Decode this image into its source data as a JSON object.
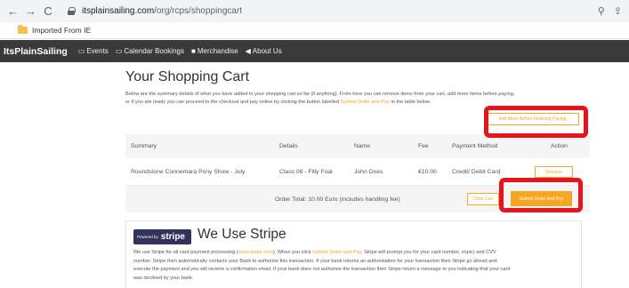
{
  "browser": {
    "url_host": "itsplainsailing.com",
    "url_path": "/org/rcps/shoppingcart",
    "bookmark": "Imported From IE"
  },
  "site_nav": {
    "brand": "ItsPlainSailing",
    "items": [
      {
        "icon": "calendar-icon",
        "label": "Events"
      },
      {
        "icon": "calendar-icon",
        "label": "Calendar Bookings"
      },
      {
        "icon": "shop-icon",
        "label": "Merchandise"
      },
      {
        "icon": "megaphone-icon",
        "label": "About Us"
      }
    ]
  },
  "cart": {
    "title": "Your Shopping Cart",
    "intro_1": "Below are the summary details of what you have added to your shopping cart so far (if anything). From here you can remove items from your cart, add more items before paying,",
    "intro_2a": "or if you are ready you can proceed to the checkout and pay online by clicking the button labelled",
    "intro_link": "Submit Order and Pay",
    "intro_2b": "in the table below.",
    "add_more_label": "Add More Before Finishing Paying",
    "table": {
      "headers": {
        "summary": "Summary",
        "details": "Details",
        "name": "Name",
        "fee": "Fee",
        "method": "Payment Method",
        "action": "Action"
      },
      "rows": [
        {
          "summary": "Roundstone Connemara Pony Show - July",
          "details": "Class 08 - Filly Foal",
          "name": "John Does",
          "fee": "€10.00",
          "method": "Credit/ Debit Card",
          "action_label": "Remove"
        }
      ],
      "total": "Order Total: 10.00 Euro (includes handling fee)",
      "clear_cart_label": "Clear Cart",
      "submit_label": "Submit Order And Pay"
    }
  },
  "stripe": {
    "badge_prefix": "Powered by",
    "badge_word": "stripe",
    "title": "We Use Stripe",
    "p1a": "We use Stripe for all card payment processing (",
    "p1_link": "www.stripe.com",
    "p1b": "). When you click",
    "p1_link2": "Submit Order and Pay",
    "p1c": ", Stripe will prompt you for your card number, expiry and CVV",
    "p2": "number. Stripe then automatically contacts your Bank to authorise this transaction. If your bank returns an authorisation for your transaction then Stripe go ahead and",
    "p3": "execute the payment and you will receive a confirmation email. If your bank does not authorise the transaction then Stripe return a message to you indicating that your card",
    "p4": "was declined by your bank."
  },
  "colors": {
    "accent": "#f5a623",
    "nav_bg": "#3a3a3a",
    "highlight": "#e8141b",
    "stripe_badge": "#32325d"
  }
}
